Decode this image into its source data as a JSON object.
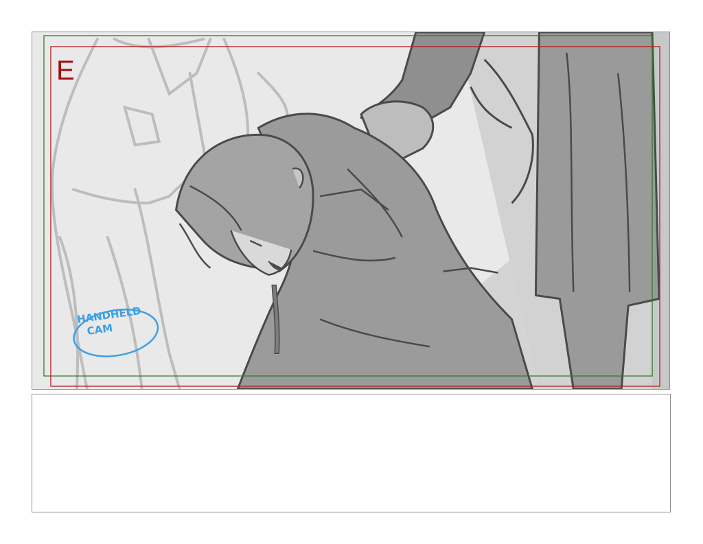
{
  "panel": {
    "scene_label": "E",
    "note": {
      "line1": "HANDHELD",
      "line2": "CAM"
    },
    "colors": {
      "scene_label": "#a30e0e",
      "note": "#3d9fe6",
      "safe_frame_red": "#b22222",
      "safe_frame_green": "#2e7d32"
    }
  },
  "notes": {
    "text": ""
  }
}
